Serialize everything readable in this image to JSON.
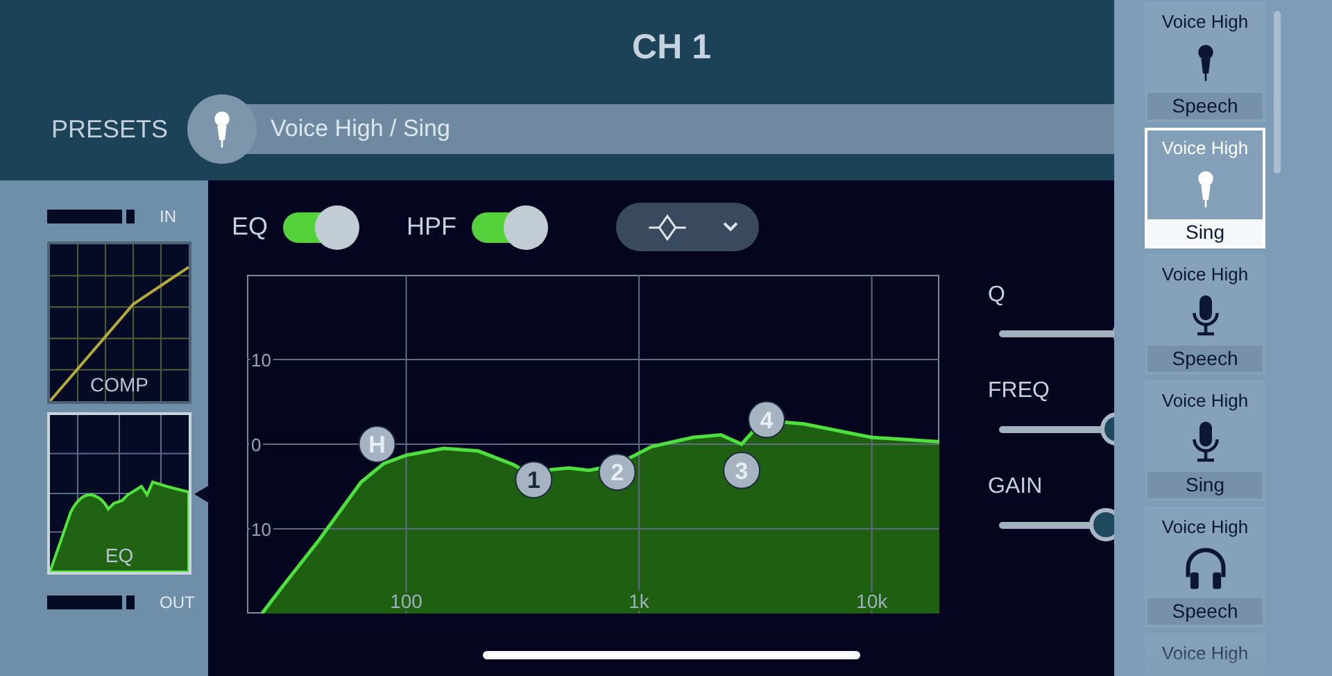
{
  "header": {
    "title": "CH 1"
  },
  "presets": {
    "label": "PRESETS",
    "value": "Voice High / Sing",
    "kind": "handheld"
  },
  "dynamics": {
    "in_label": "IN",
    "out_label": "OUT",
    "modules": [
      {
        "kind": "comp",
        "label": "COMP",
        "selected": false
      },
      {
        "kind": "eq",
        "label": "EQ",
        "selected": true
      }
    ]
  },
  "eq_panel": {
    "toggles": [
      {
        "label": "EQ",
        "on": true
      },
      {
        "label": "HPF",
        "on": true
      }
    ],
    "graph": {
      "x_labels": [
        "100",
        "1k",
        "10k"
      ],
      "y_labels": [
        "10",
        "0",
        "10"
      ],
      "bands": [
        {
          "label": "H",
          "selected": false
        },
        {
          "label": "1",
          "selected": true
        },
        {
          "label": "2",
          "selected": false
        },
        {
          "label": "3",
          "selected": false
        },
        {
          "label": "4",
          "selected": false
        }
      ]
    },
    "sliders": [
      {
        "label": "Q",
        "level": 0.78
      },
      {
        "label": "FREQ",
        "level": 0.71
      },
      {
        "label": "GAIN",
        "level": 0.64
      }
    ]
  },
  "preset_list": [
    {
      "title": "Voice High",
      "subtitle": "Speech",
      "kind": "handheld",
      "selected": false
    },
    {
      "title": "Voice High",
      "subtitle": "Sing",
      "kind": "handheld",
      "selected": true
    },
    {
      "title": "Voice High",
      "subtitle": "Speech",
      "kind": "studio",
      "selected": false
    },
    {
      "title": "Voice High",
      "subtitle": "Sing",
      "kind": "studio",
      "selected": false
    },
    {
      "title": "Voice High",
      "subtitle": "Speech",
      "kind": "headphones",
      "selected": false
    },
    {
      "title": "Voice High",
      "selected": false
    }
  ]
}
